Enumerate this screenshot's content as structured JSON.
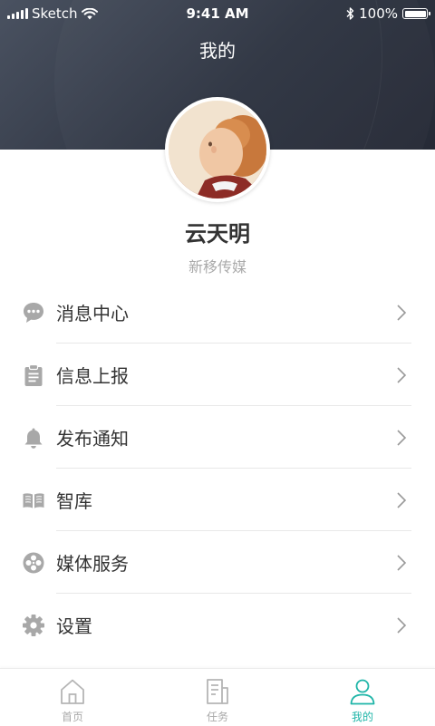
{
  "status_bar": {
    "carrier": "Sketch",
    "time": "9:41 AM",
    "battery": "100%"
  },
  "header": {
    "title": "我的"
  },
  "profile": {
    "name": "云天明",
    "organization": "新移传媒"
  },
  "menu": [
    {
      "label": "消息中心",
      "icon": "chat-bubble-icon"
    },
    {
      "label": "信息上报",
      "icon": "clipboard-icon"
    },
    {
      "label": "发布通知",
      "icon": "bell-icon"
    },
    {
      "label": "智库",
      "icon": "book-icon"
    },
    {
      "label": "媒体服务",
      "icon": "film-reel-icon"
    },
    {
      "label": "设置",
      "icon": "gear-icon"
    }
  ],
  "tabbar": {
    "tabs": [
      {
        "label": "首页",
        "icon": "home-icon",
        "active": false
      },
      {
        "label": "任务",
        "icon": "document-icon",
        "active": false
      },
      {
        "label": "我的",
        "icon": "person-icon",
        "active": true
      }
    ]
  },
  "colors": {
    "accent": "#1fb5a8",
    "header_bg": "#2f3542",
    "icon_gray": "#a8a8a8"
  }
}
